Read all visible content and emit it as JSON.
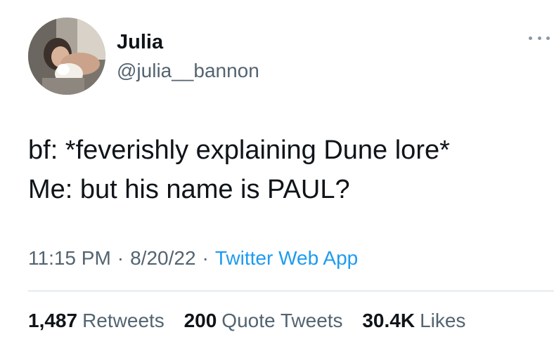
{
  "tweet": {
    "author": {
      "display_name": "Julia",
      "handle": "@julia__bannon",
      "avatar_icon": "profile-photo"
    },
    "more_icon": "more-options-icon",
    "text_lines": [
      "bf: *feverishly explaining Dune lore*",
      "Me: but his name is PAUL?"
    ],
    "meta": {
      "time": "11:15 PM",
      "separator": "·",
      "date": "8/20/22",
      "source": "Twitter Web App"
    },
    "stats": {
      "retweets_count": "1,487",
      "retweets_label": "Retweets",
      "quote_count": "200",
      "quote_label": "Quote Tweets",
      "likes_count": "30.4K",
      "likes_label": "Likes"
    }
  },
  "colors": {
    "text": "#0f1419",
    "secondary": "#536471",
    "link": "#1d9bf0",
    "divider": "#cfd9de"
  }
}
